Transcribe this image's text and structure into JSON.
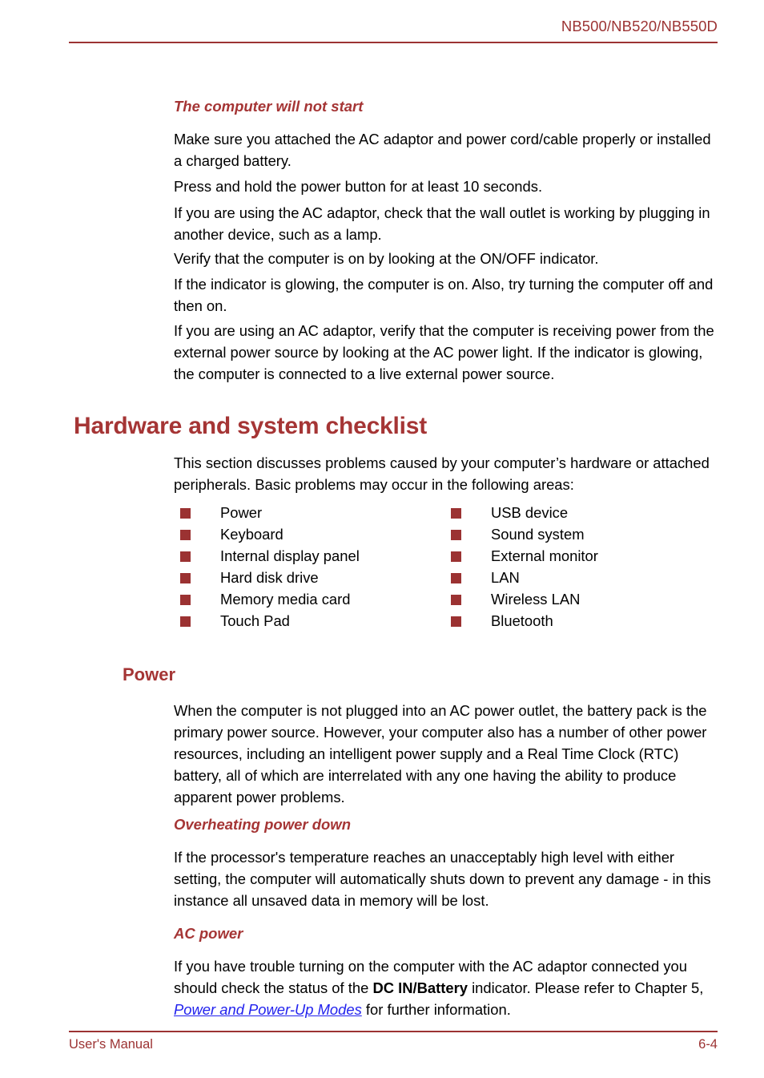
{
  "header": {
    "model_text": "NB500/NB520/NB550D"
  },
  "footer": {
    "manual_label": "User's Manual",
    "page_number": "6-4"
  },
  "colors": {
    "accent_red": "#9C3333",
    "heading_red": "#A53535",
    "bullet_red": "#9B3232",
    "link_blue": "#2222EE",
    "body_black": "#000000"
  },
  "content": {
    "sub_head_1": "The computer will not start",
    "para_1": "Make sure you attached the AC adaptor and power cord/cable properly or installed a charged battery.",
    "para_2": "Press and hold the power button for at least 10 seconds.",
    "para_3": "If you are using the AC adaptor, check that the wall outlet is working by plugging in another device, such as a lamp.",
    "para_4": "Verify that the computer is on by looking at the ON/OFF indicator.",
    "para_5": "If the indicator is glowing, the computer is on. Also, try turning the computer off and then on.",
    "para_6": "If you are using an AC adaptor, verify that the computer is receiving power from the external power source by looking at the AC power light. If the indicator is glowing, the computer is connected to a live external power source.",
    "chapter_heading": "Hardware and system checklist",
    "para_7": "This section discusses problems caused by your computer’s hardware or attached peripherals. Basic problems may occur in the following areas:",
    "checklist": {
      "left_column": [
        "Power",
        "Keyboard",
        "Internal display panel",
        "Hard disk drive",
        "Memory media card",
        "Touch Pad"
      ],
      "right_column": [
        "USB device",
        "Sound system",
        "External monitor",
        "LAN",
        "Wireless LAN",
        "Bluetooth"
      ]
    },
    "section_head_power": "Power",
    "para_8": "When the computer is not plugged into an AC power outlet, the battery pack is the primary power source. However, your computer also has a number of other power resources, including an intelligent power supply and a Real Time Clock (RTC) battery, all of which are interrelated with any one having the ability to produce apparent power problems.",
    "sub_head_2": "Overheating power down",
    "para_9": "If the processor's temperature reaches an unacceptably high level with either setting, the computer will automatically shuts down to prevent any damage - in this instance all unsaved data in memory will be lost.",
    "sub_head_3": "AC power",
    "para_10": {
      "part_1": "If you have trouble turning on the computer with the AC adaptor connected you should check the status of the ",
      "bold": "DC IN/Battery",
      "part_2": " indicator. Please refer to Chapter 5, ",
      "link": "Power and Power-Up Modes",
      "part_3": " for further information."
    }
  }
}
